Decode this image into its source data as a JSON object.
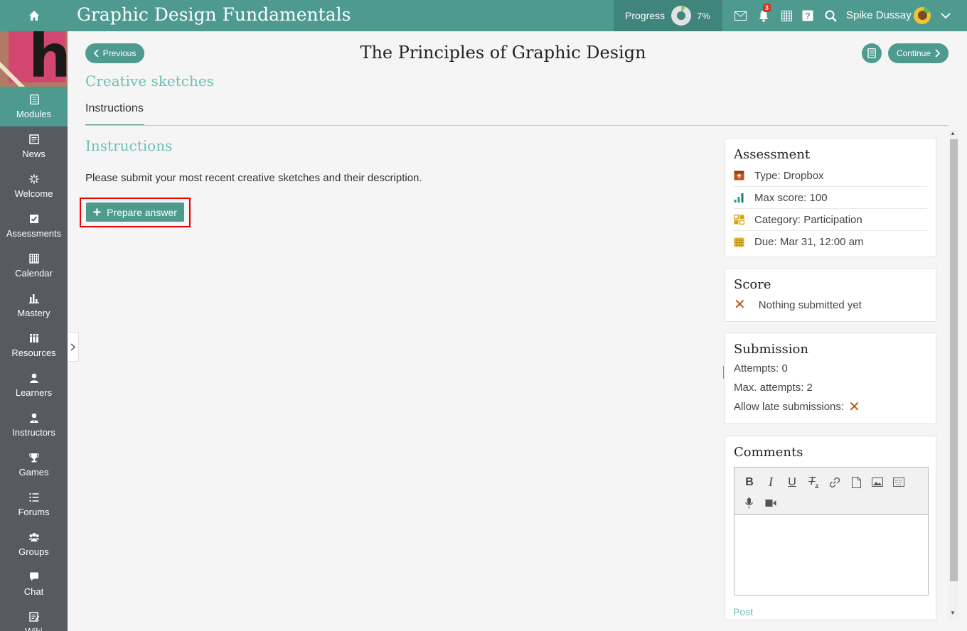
{
  "header": {
    "course_title": "Graphic Design Fundamentals",
    "progress_label": "Progress",
    "progress_value": "7%",
    "progress_fraction": 0.07,
    "notification_count": "3",
    "user_name": "Spike Dussay",
    "icons": [
      "home-icon",
      "mail-icon",
      "bell-icon",
      "calendar-grid-icon",
      "help-icon",
      "search-icon",
      "chevron-down-icon"
    ]
  },
  "sidebar": {
    "items": [
      {
        "label": "Modules",
        "icon": "modules-icon",
        "active": true
      },
      {
        "label": "News",
        "icon": "news-icon"
      },
      {
        "label": "Welcome",
        "icon": "welcome-icon"
      },
      {
        "label": "Assessments",
        "icon": "assessments-icon"
      },
      {
        "label": "Calendar",
        "icon": "calendar-icon"
      },
      {
        "label": "Mastery",
        "icon": "mastery-icon"
      },
      {
        "label": "Resources",
        "icon": "resources-icon"
      },
      {
        "label": "Learners",
        "icon": "learners-icon"
      },
      {
        "label": "Instructors",
        "icon": "instructors-icon"
      },
      {
        "label": "Games",
        "icon": "trophy-icon"
      },
      {
        "label": "Forums",
        "icon": "forums-icon"
      },
      {
        "label": "Groups",
        "icon": "groups-icon"
      },
      {
        "label": "Chat",
        "icon": "chat-icon"
      },
      {
        "label": "Wiki",
        "icon": "wiki-icon"
      }
    ]
  },
  "nav": {
    "previous_label": "Previous",
    "continue_label": "Continue"
  },
  "main": {
    "page_title": "The Principles of Graphic Design",
    "section_title": "Creative sketches",
    "tab_label": "Instructions",
    "instructions_heading": "Instructions",
    "instructions_text": "Please submit your most recent creative sketches and their description.",
    "prepare_answer_label": "Prepare answer"
  },
  "assessment": {
    "title": "Assessment",
    "type": "Type: Dropbox",
    "max_score": "Max score: 100",
    "category": "Category: Participation",
    "due": "Due: Mar 31, 12:00 am"
  },
  "score": {
    "title": "Score",
    "status": "Nothing submitted yet"
  },
  "submission": {
    "title": "Submission",
    "attempts": "Attempts: 0",
    "max_attempts": "Max. attempts: 2",
    "late_label": "Allow late submissions:"
  },
  "comments": {
    "title": "Comments",
    "post_label": "Post",
    "toolbar": [
      "bold",
      "italic",
      "underline",
      "clear-format",
      "link",
      "file",
      "image",
      "keyboard",
      "microphone",
      "video"
    ]
  },
  "colors": {
    "accent": "#4e9a8f",
    "accent_light": "#6cc0b2",
    "sidebar": "#555b60",
    "warning": "#c0531a"
  }
}
